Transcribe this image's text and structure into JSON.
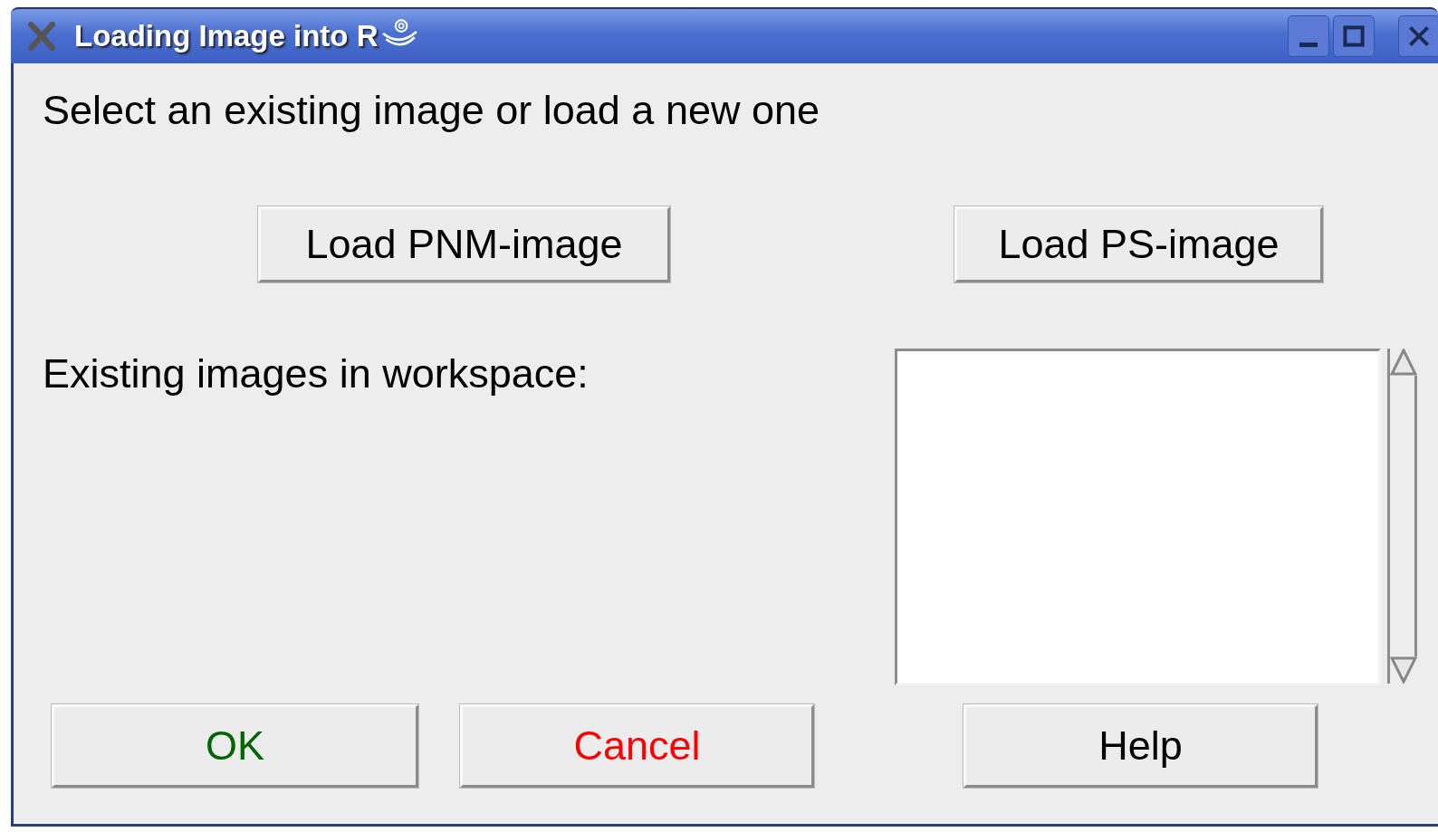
{
  "window": {
    "title": "Loading Image into R"
  },
  "prompt": "Select an existing image or load a new one",
  "load_buttons": [
    {
      "label": "Load PNM-image"
    },
    {
      "label": "Load PS-image"
    }
  ],
  "list_label": "Existing images in workspace:",
  "buttons": [
    {
      "label": "OK",
      "color": "#006400"
    },
    {
      "label": "Cancel",
      "color": "#ff0000"
    },
    {
      "label": "Help",
      "color": "#000000"
    }
  ]
}
